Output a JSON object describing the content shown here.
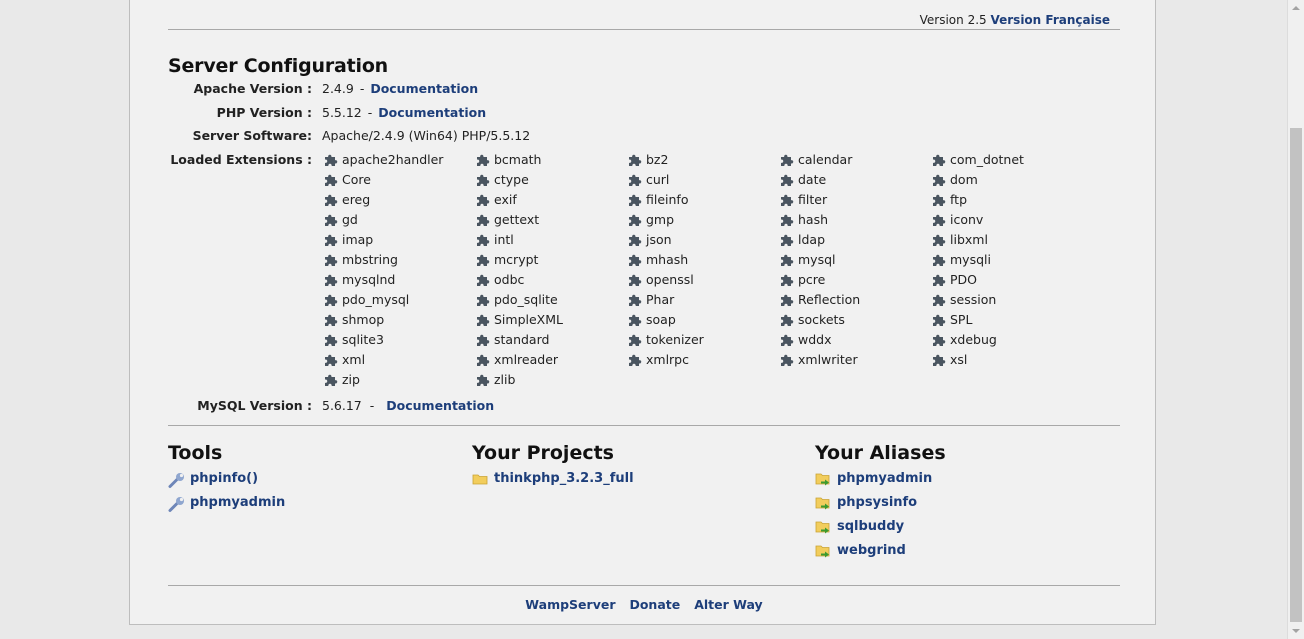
{
  "header": {
    "version_label": "Version 2.5",
    "language_link": "Version Française"
  },
  "server": {
    "title": "Server Configuration",
    "apache": {
      "label": "Apache Version :",
      "value": "2.4.9",
      "sep": "-",
      "doc": "Documentation"
    },
    "php": {
      "label": "PHP Version :",
      "value": "5.5.12",
      "sep": "-",
      "doc": "Documentation"
    },
    "software": {
      "label": "Server Software:",
      "value": "Apache/2.4.9 (Win64) PHP/5.5.12"
    },
    "extensions_label": "Loaded Extensions :",
    "extensions": [
      "apache2handler",
      "bcmath",
      "bz2",
      "calendar",
      "com_dotnet",
      "Core",
      "ctype",
      "curl",
      "date",
      "dom",
      "ereg",
      "exif",
      "fileinfo",
      "filter",
      "ftp",
      "gd",
      "gettext",
      "gmp",
      "hash",
      "iconv",
      "imap",
      "intl",
      "json",
      "ldap",
      "libxml",
      "mbstring",
      "mcrypt",
      "mhash",
      "mysql",
      "mysqli",
      "mysqlnd",
      "odbc",
      "openssl",
      "pcre",
      "PDO",
      "pdo_mysql",
      "pdo_sqlite",
      "Phar",
      "Reflection",
      "session",
      "shmop",
      "SimpleXML",
      "soap",
      "sockets",
      "SPL",
      "sqlite3",
      "standard",
      "tokenizer",
      "wddx",
      "xdebug",
      "xml",
      "xmlreader",
      "xmlrpc",
      "xmlwriter",
      "xsl",
      "zip",
      "zlib"
    ],
    "mysql": {
      "label": "MySQL Version :",
      "value": "5.6.17",
      "sep": "-",
      "doc": "Documentation"
    }
  },
  "tools": {
    "title": "Tools",
    "items": [
      "phpinfo()",
      "phpmyadmin"
    ]
  },
  "projects": {
    "title": "Your Projects",
    "items": [
      "thinkphp_3.2.3_full"
    ]
  },
  "aliases": {
    "title": "Your Aliases",
    "items": [
      "phpmyadmin",
      "phpsysinfo",
      "sqlbuddy",
      "webgrind"
    ]
  },
  "footer": {
    "links": [
      "WampServer",
      "Donate",
      "Alter Way"
    ]
  },
  "colors": {
    "link": "#1d3e7a",
    "puzzle": "#4a5560",
    "folder": "#f2cd5c",
    "alias_arrow": "#3c9a2f"
  }
}
